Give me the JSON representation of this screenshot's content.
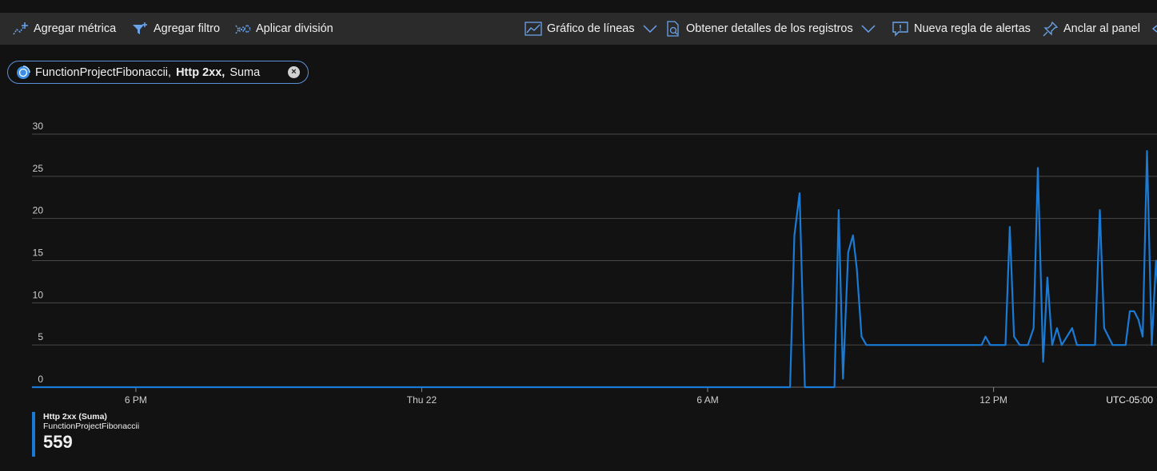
{
  "toolbar": {
    "add_metric": "Agregar métrica",
    "add_filter": "Agregar filtro",
    "apply_split": "Aplicar división",
    "line_chart": "Gráfico de líneas",
    "get_logs": "Obtener detalles de los registros",
    "new_alert": "Nueva regla de alertas",
    "pin_dashboard": "Anclar al panel"
  },
  "pill": {
    "resource": "FunctionProjectFibonaccii,",
    "metric": "Http 2xx,",
    "aggregation": "Suma"
  },
  "legend": {
    "title": "Http 2xx (Suma)",
    "subtitle": "FunctionProjectFibonaccii",
    "total": "559"
  },
  "colors": {
    "series": "#1a7bd6",
    "background": "#121212",
    "toolbar": "#2b2b2b",
    "grid": "#4a4a4a"
  },
  "chart_data": {
    "type": "line",
    "title": "",
    "xlabel": "",
    "ylabel": "",
    "timezone_label": "UTC-05:00",
    "ylim": [
      0,
      30
    ],
    "y_ticks": [
      0,
      5,
      10,
      15,
      20,
      25,
      30
    ],
    "x_unit": "hours from 6 PM",
    "xlim": [
      -2.18,
      21.43
    ],
    "x_ticks": [
      {
        "x": 0,
        "label": "6 PM"
      },
      {
        "x": 6,
        "label": "Thu 22"
      },
      {
        "x": 12,
        "label": "6 AM"
      },
      {
        "x": 18,
        "label": "12 PM"
      }
    ],
    "grid": true,
    "series": [
      {
        "name": "Http 2xx (Suma)",
        "points": [
          [
            -2.18,
            0
          ],
          [
            13.73,
            0
          ],
          [
            13.82,
            18
          ],
          [
            13.93,
            23
          ],
          [
            14.04,
            0
          ],
          [
            14.66,
            0
          ],
          [
            14.75,
            21
          ],
          [
            14.84,
            1
          ],
          [
            14.95,
            16
          ],
          [
            15.05,
            18
          ],
          [
            15.13,
            14
          ],
          [
            15.23,
            6
          ],
          [
            15.33,
            5
          ],
          [
            16.2,
            5
          ],
          [
            17.75,
            5
          ],
          [
            17.83,
            6
          ],
          [
            17.93,
            5
          ],
          [
            18.25,
            5
          ],
          [
            18.34,
            19
          ],
          [
            18.43,
            6
          ],
          [
            18.55,
            5
          ],
          [
            18.72,
            5
          ],
          [
            18.84,
            7
          ],
          [
            18.93,
            26
          ],
          [
            19.04,
            3
          ],
          [
            19.13,
            13
          ],
          [
            19.23,
            5
          ],
          [
            19.33,
            7
          ],
          [
            19.43,
            5
          ],
          [
            19.54,
            6
          ],
          [
            19.65,
            7
          ],
          [
            19.75,
            5
          ],
          [
            20.13,
            5
          ],
          [
            20.23,
            21
          ],
          [
            20.32,
            7
          ],
          [
            20.5,
            5
          ],
          [
            20.77,
            5
          ],
          [
            20.86,
            9
          ],
          [
            20.95,
            9
          ],
          [
            21.04,
            8
          ],
          [
            21.13,
            6
          ],
          [
            21.22,
            28
          ],
          [
            21.32,
            5
          ],
          [
            21.41,
            15
          ],
          [
            21.5,
            8
          ]
        ]
      }
    ]
  }
}
